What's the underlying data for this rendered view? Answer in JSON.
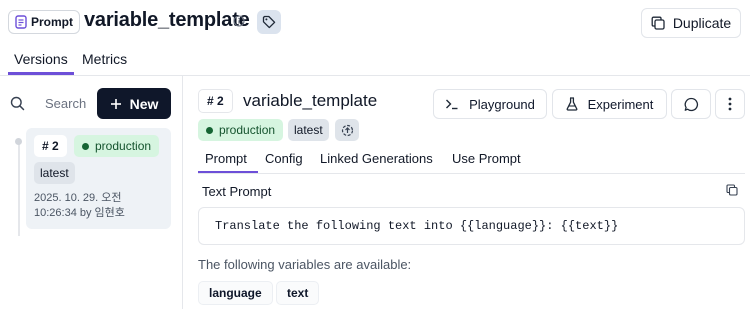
{
  "header": {
    "prompt_badge": "Prompt",
    "title": "variable_template",
    "duplicate_label": "Duplicate"
  },
  "tabs": {
    "versions": "Versions",
    "metrics": "Metrics"
  },
  "left": {
    "search_placeholder": "Search",
    "new_label": "New",
    "version_card": {
      "number": "# 2",
      "label": "production",
      "tag": "latest",
      "date_line1": "2025. 10. 29. 오전",
      "date_line2": "10:26:34 by 임현호"
    }
  },
  "detail": {
    "number": "# 2",
    "title": "variable_template",
    "playground_label": "Playground",
    "experiment_label": "Experiment",
    "badge_production": "production",
    "badge_latest": "latest",
    "subtabs": [
      "Prompt",
      "Config",
      "Linked Generations",
      "Use Prompt"
    ],
    "text_prompt_label": "Text Prompt",
    "prompt_text": "Translate the following text into {{language}}: {{text}}",
    "variables_text": "The following variables are available:",
    "variables": [
      "language",
      "text"
    ]
  },
  "colors": {
    "accent": "#6d4fd8",
    "success": "#166534",
    "dark_button": "#0f172a"
  }
}
